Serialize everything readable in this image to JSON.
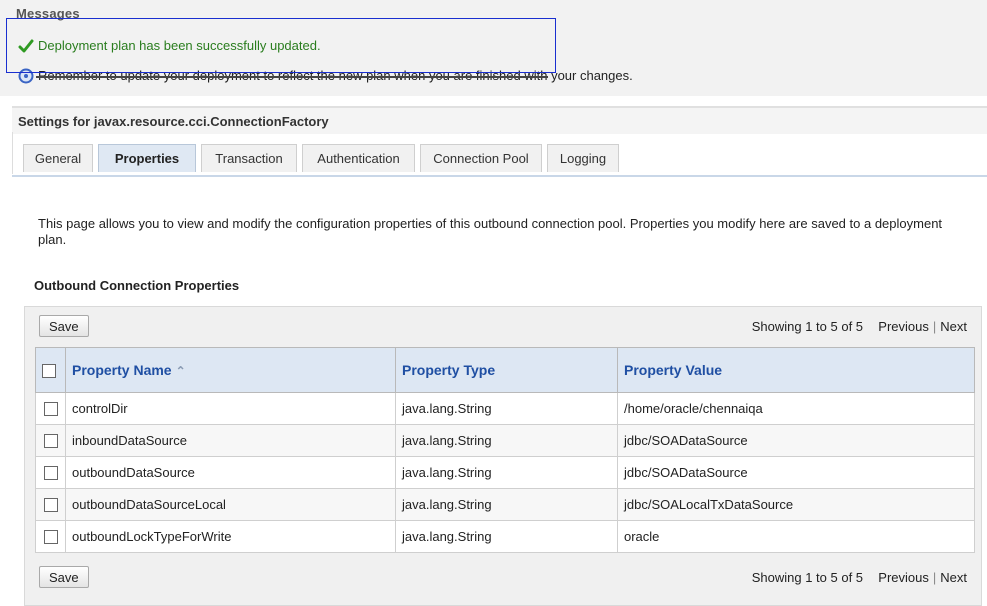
{
  "messages": {
    "title": "Messages",
    "success": "Deployment plan has been successfully updated.",
    "info": "Remember to update your deployment to reflect the new plan when you are finished with your changes."
  },
  "settings": {
    "header": "Settings for javax.resource.cci.ConnectionFactory",
    "tabs": [
      {
        "label": "General"
      },
      {
        "label": "Properties",
        "active": true
      },
      {
        "label": "Transaction"
      },
      {
        "label": "Authentication"
      },
      {
        "label": "Connection Pool"
      },
      {
        "label": "Logging"
      }
    ],
    "description": "This page allows you to view and modify the configuration properties of this outbound connection pool. Properties you modify here are saved to a deployment plan."
  },
  "outbound": {
    "title": "Outbound Connection Properties",
    "save_label": "Save",
    "pager": {
      "showing": "Showing 1 to 5 of 5",
      "previous": "Previous",
      "next": "Next"
    },
    "columns": {
      "name": "Property Name",
      "type": "Property Type",
      "value": "Property Value"
    },
    "rows": [
      {
        "name": "controlDir",
        "type": "java.lang.String",
        "value": "/home/oracle/chennaiqa"
      },
      {
        "name": "inboundDataSource",
        "type": "java.lang.String",
        "value": "jdbc/SOADataSource"
      },
      {
        "name": "outboundDataSource",
        "type": "java.lang.String",
        "value": "jdbc/SOADataSource"
      },
      {
        "name": "outboundDataSourceLocal",
        "type": "java.lang.String",
        "value": "jdbc/SOALocalTxDataSource"
      },
      {
        "name": "outboundLockTypeForWrite",
        "type": "java.lang.String",
        "value": "oracle"
      }
    ]
  },
  "colors": {
    "success": "#2a7d1e",
    "highlight": "#1a2fd0",
    "header_link": "#1f4fa3"
  },
  "icons": {
    "success": "checkmark-icon",
    "info": "info-icon",
    "sort": "sort-ascending-icon"
  }
}
